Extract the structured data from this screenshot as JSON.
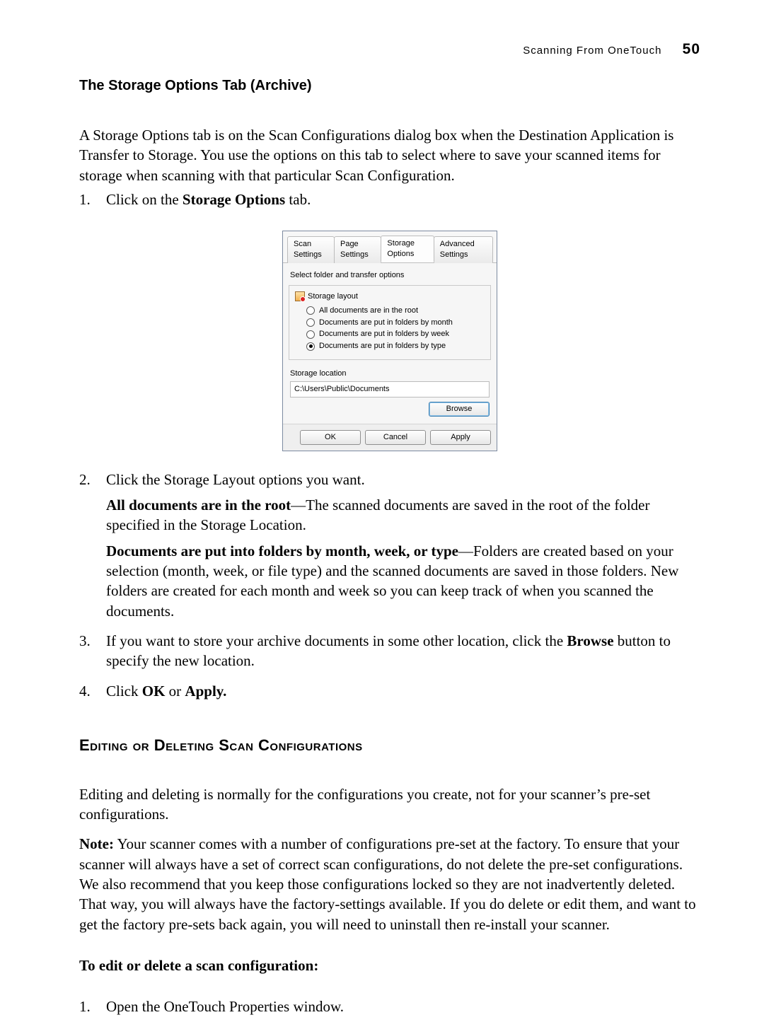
{
  "header": {
    "running": "Scanning From OneTouch",
    "page_number": "50"
  },
  "section1": {
    "title": "The Storage Options Tab (Archive)",
    "intro": "A Storage Options tab is on the Scan Configurations dialog box when the Destination Application is Transfer to Storage. You use the options on this tab to select where to save your scanned items for storage when scanning with that particular Scan Configuration.",
    "step1_pre": "Click on the ",
    "step1_bold": "Storage Options",
    "step1_post": " tab.",
    "step2": "Click the Storage Layout options you want.",
    "step2_sub1_bold": "All documents are in the root",
    "step2_sub1_rest": "—The scanned documents are saved in the root of the folder specified in the Storage Location.",
    "step2_sub2_bold": "Documents are put into folders by month, week, or type",
    "step2_sub2_rest": "—Folders are created based on your selection (month, week, or file type) and the scanned documents are saved in those folders. New folders are created for each month and week so you can keep track of when you scanned the documents.",
    "step3_pre": "If you want to store your archive documents in some other location, click the ",
    "step3_bold": "Browse",
    "step3_post": " button to specify the new location.",
    "step4_pre": "Click ",
    "step4_b1": "OK",
    "step4_mid": " or ",
    "step4_b2": "Apply."
  },
  "dialog": {
    "tabs": [
      "Scan Settings",
      "Page Settings",
      "Storage Options",
      "Advanced Settings"
    ],
    "group_label": "Select folder and transfer options",
    "legend": "Storage layout",
    "radios": [
      "All documents are in the root",
      "Documents are put in folders by month",
      "Documents are put in folders by week",
      "Documents are put in folders by type"
    ],
    "selected_radio_index": 3,
    "location_label": "Storage location",
    "path": "C:\\Users\\Public\\Documents",
    "browse": "Browse",
    "ok": "OK",
    "cancel": "Cancel",
    "apply": "Apply"
  },
  "section2": {
    "title": "Editing or Deleting Scan Configurations",
    "p1": "Editing and deleting is normally for the configurations you create, not for your scanner’s pre-set configurations.",
    "p2_bold": "Note:",
    "p2_rest": " Your scanner comes with a number of configurations pre-set at the factory. To ensure that your scanner will always have a set of correct scan configurations, do not delete the pre-set configurations. We also recommend that you keep those configurations locked so they are not inadvertently deleted. That way, you will always have the factory-settings available. If you do delete or edit them, and want to get the factory pre-sets back again, you will need to uninstall then re-install your scanner.",
    "sub": "To edit or delete a scan configuration:",
    "step1": "Open the OneTouch Properties window."
  }
}
